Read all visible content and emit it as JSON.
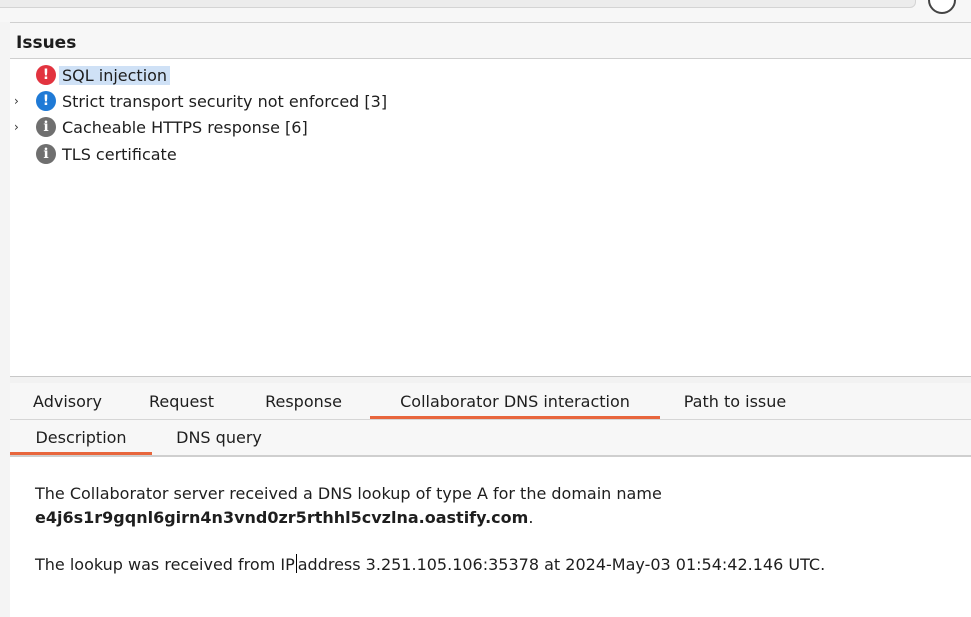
{
  "issues_panel": {
    "title": "Issues",
    "items": [
      {
        "label": "SQL injection",
        "severity": "high",
        "icon": "error-icon",
        "expandable": false,
        "selected": true
      },
      {
        "label": "Strict transport security not enforced [3]",
        "severity": "info",
        "icon": "info-icon",
        "expandable": true,
        "selected": false
      },
      {
        "label": "Cacheable HTTPS response [6]",
        "severity": "info",
        "icon": "info-grey-icon",
        "expandable": true,
        "selected": false
      },
      {
        "label": "TLS certificate",
        "severity": "info",
        "icon": "info-grey-icon",
        "expandable": false,
        "selected": false
      }
    ]
  },
  "detail_tabs": {
    "tabs": [
      "Advisory",
      "Request",
      "Response",
      "Collaborator DNS interaction",
      "Path to issue"
    ],
    "active": "Collaborator DNS interaction"
  },
  "sub_tabs": {
    "tabs": [
      "Description",
      "DNS query"
    ],
    "active": "Description"
  },
  "description": {
    "line1": "The Collaborator server received a DNS lookup of type A for the domain name",
    "domain": "e4j6s1r9gqnl6girn4n3vnd0zr5rthhl5cvzlna.oastify.com",
    "domain_suffix": ".",
    "line3_before_caret": "The lookup was received from IP",
    "line3_after_caret": "address 3.251.105.106:35378 at 2024-May-03 01:54:42.146 UTC."
  },
  "colors": {
    "accent": "#e8663d",
    "selection": "#cfe1f6",
    "high_severity": "#e2333f",
    "info_blue": "#1f7ad6",
    "info_grey": "#6f6f6f"
  }
}
